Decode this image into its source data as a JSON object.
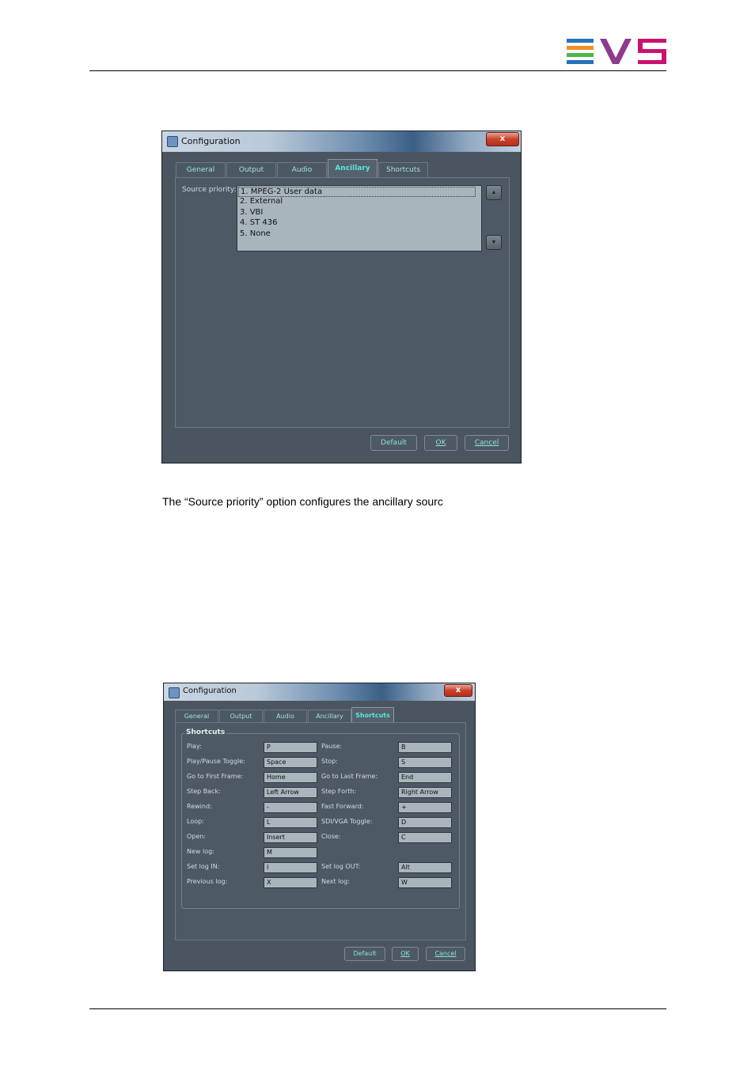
{
  "colors": {
    "evs_blue": "#2673b8",
    "evs_orange": "#f28c22",
    "evs_green": "#4bb748",
    "evs_purple": "#8e3a8e",
    "evs_magenta": "#c8146e",
    "tab_text": "#57e8df"
  },
  "caption": "The “Source priority” option configures the ancillary sourc",
  "window1": {
    "title": "Configuration",
    "close": "x",
    "tabs": [
      "General",
      "Output",
      "Audio",
      "Ancillary",
      "Shortcuts"
    ],
    "active_tab": "Ancillary",
    "source_priority_label": "Source priority:",
    "source_list": [
      "1. MPEG-2 User data",
      "2. External",
      "3. VBI",
      "4. ST 436",
      "5. None"
    ],
    "buttons": {
      "default": "Default",
      "ok": "OK",
      "cancel": "Cancel"
    }
  },
  "window2": {
    "title": "Configuration",
    "close": "x",
    "tabs": [
      "General",
      "Output",
      "Audio",
      "Ancillary",
      "Shortcuts"
    ],
    "active_tab": "Shortcuts",
    "group_title": "Shortcuts",
    "shortcuts": [
      {
        "label": "Play:",
        "value": "P"
      },
      {
        "label": "Pause:",
        "value": "B"
      },
      {
        "label": "Play/Pause Toggle:",
        "value": "Space"
      },
      {
        "label": "Stop:",
        "value": "S"
      },
      {
        "label": "Go to First Frame:",
        "value": "Home"
      },
      {
        "label": "Go to Last Frame:",
        "value": "End"
      },
      {
        "label": "Step Back:",
        "value": "Left Arrow"
      },
      {
        "label": "Step Forth:",
        "value": "Right Arrow"
      },
      {
        "label": "Rewind:",
        "value": "-"
      },
      {
        "label": "Fast Forward:",
        "value": "+"
      },
      {
        "label": "Loop:",
        "value": "L"
      },
      {
        "label": "SDI/VGA Toggle:",
        "value": "D"
      },
      {
        "label": "Open:",
        "value": "Insert"
      },
      {
        "label": "Close:",
        "value": "C"
      },
      {
        "label": "New log:",
        "value": "M"
      },
      {
        "label": "Set log IN:",
        "value": "I"
      },
      {
        "label": "Set log OUT:",
        "value": "Alt"
      },
      {
        "label": "Previous log:",
        "value": "X"
      },
      {
        "label": "Next log:",
        "value": "W"
      }
    ],
    "buttons": {
      "default": "Default",
      "ok": "OK",
      "cancel": "Cancel"
    }
  }
}
